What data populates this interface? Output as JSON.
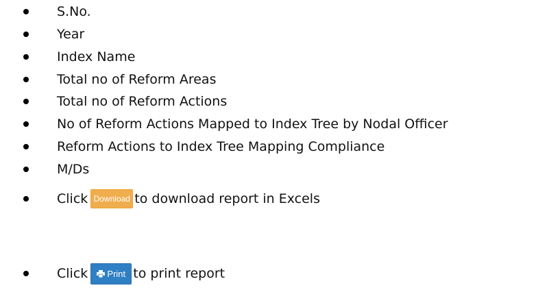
{
  "bullets": [
    "S.No.",
    "Year",
    "Index Name",
    "Total no of Reform Areas",
    "Total no of Reform Actions",
    "No of Reform Actions Mapped to Index Tree by Nodal Officer",
    "Reform Actions to Index Tree Mapping Compliance",
    "M/Ds"
  ],
  "download_row": {
    "prefix": "Click",
    "button_label": "Download",
    "suffix": "to download report in Excels"
  },
  "print_row": {
    "prefix": "Click",
    "button_label": "Print",
    "suffix": "to print report"
  },
  "colors": {
    "download_button": "#f0ad4e",
    "print_button": "#2f7fc5"
  }
}
